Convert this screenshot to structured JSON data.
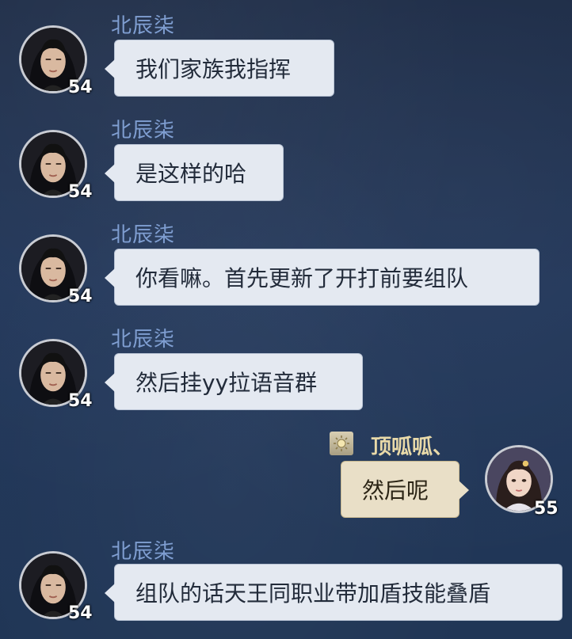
{
  "messages": [
    {
      "side": "left",
      "sender": "北辰柒",
      "level": "54",
      "text": "我们家族我指挥"
    },
    {
      "side": "left",
      "sender": "北辰柒",
      "level": "54",
      "text": "是这样的哈"
    },
    {
      "side": "left",
      "sender": "北辰柒",
      "level": "54",
      "text": "你看嘛。首先更新了开打前要组队"
    },
    {
      "side": "left",
      "sender": "北辰柒",
      "level": "54",
      "text": "然后挂yy拉语音群"
    },
    {
      "side": "right",
      "sender": "顶呱呱、",
      "level": "55",
      "text": "然后呢",
      "badge_icon": "sun-icon"
    },
    {
      "side": "left",
      "sender": "北辰柒",
      "level": "54",
      "text": "组队的话天王同职业带加盾技能叠盾"
    }
  ],
  "colors": {
    "left_bubble": "#e4e9f1",
    "right_bubble": "#e9dfc7",
    "left_name": "#7f9ed1",
    "right_name": "#e8d9a8"
  }
}
